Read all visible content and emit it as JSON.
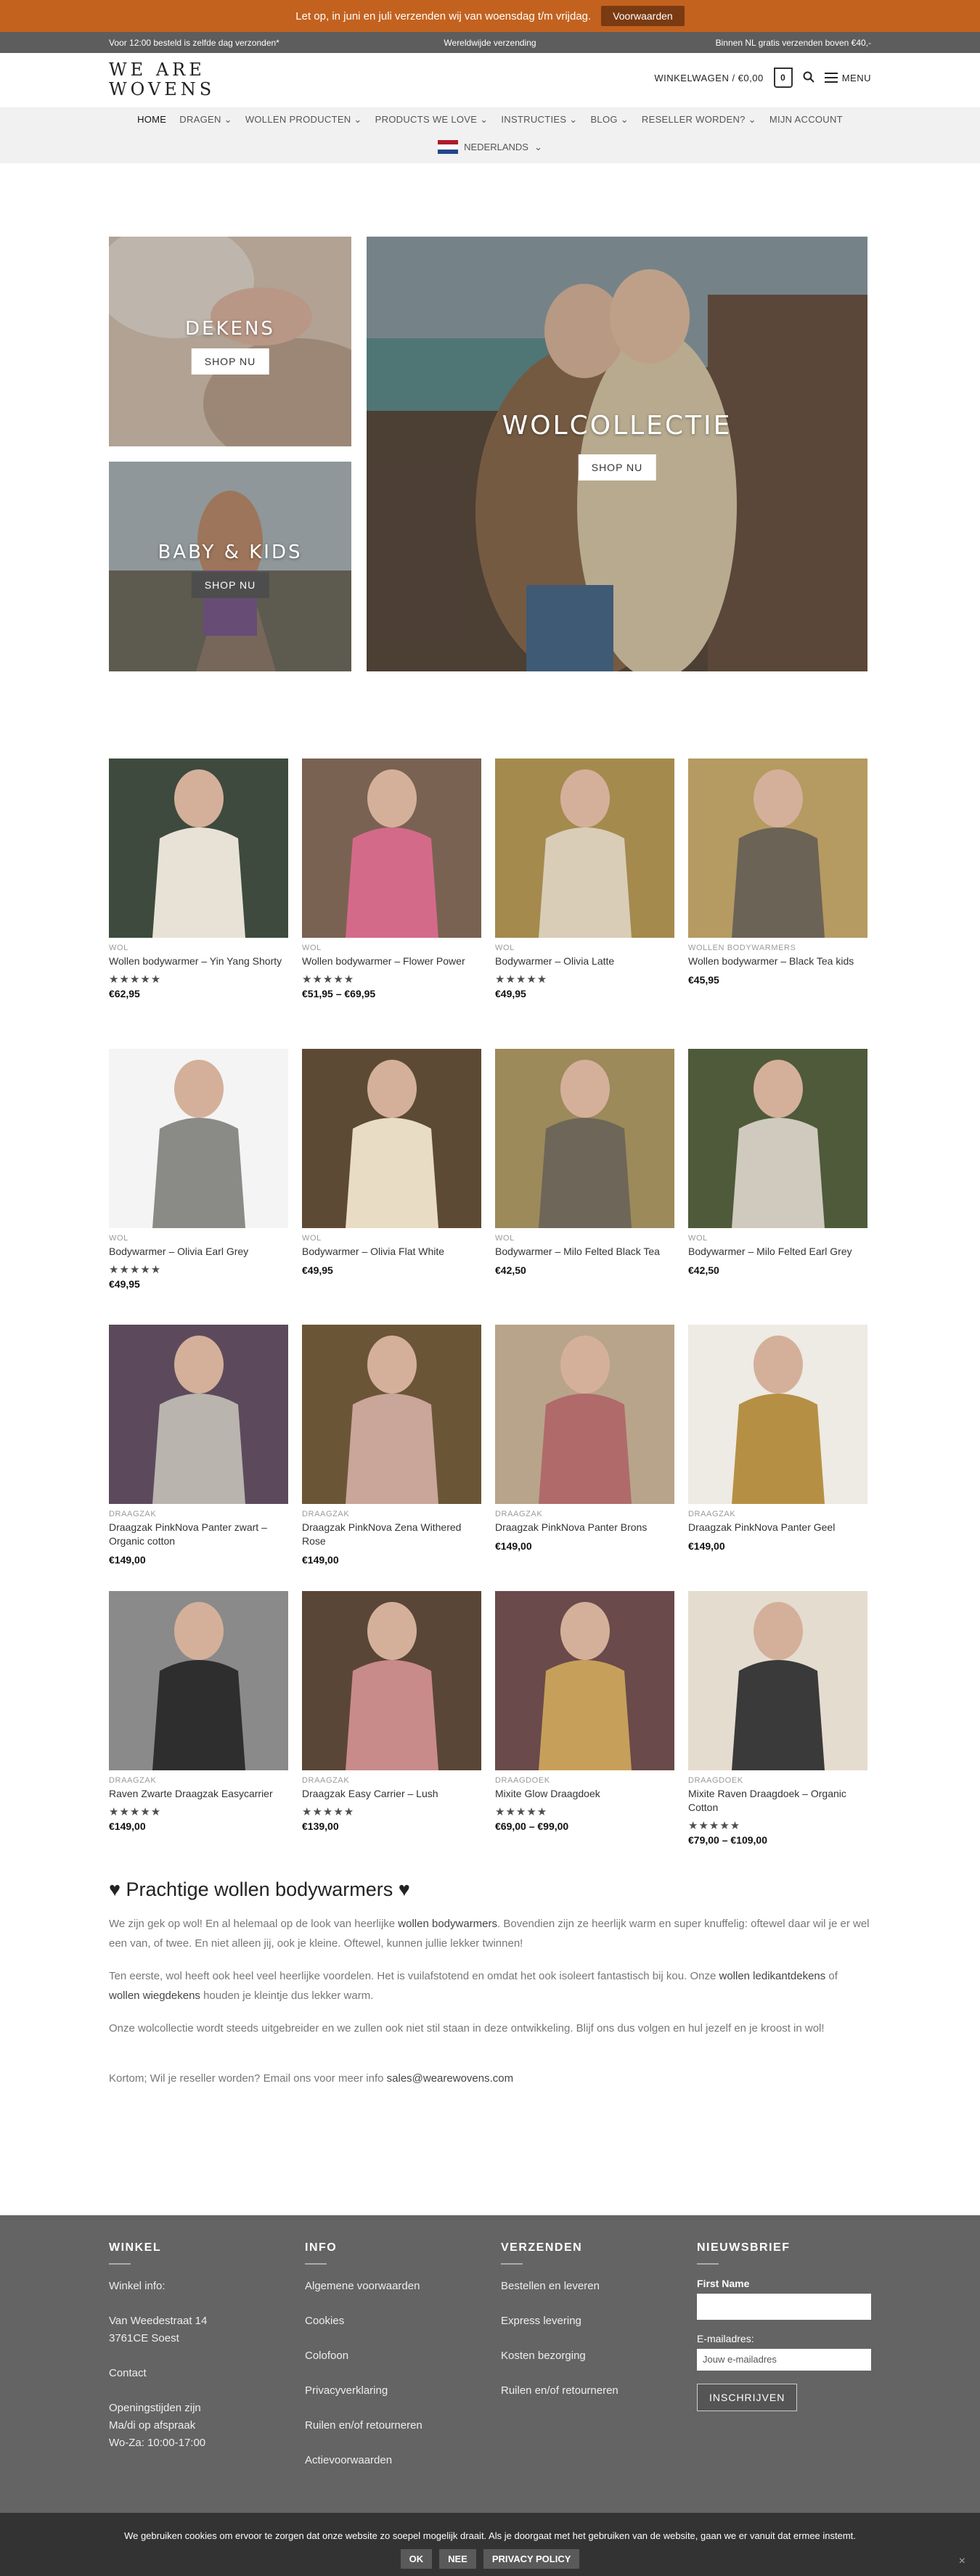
{
  "notice": {
    "text": "Let op, in juni en juli verzenden wij van woensdag t/m vrijdag.",
    "button": "Voorwaarden"
  },
  "strip": {
    "left": "Voor 12:00 besteld is zelfde dag verzonden*",
    "center": "Wereldwijde verzending",
    "right": "Binnen NL gratis verzenden boven €40,-"
  },
  "header": {
    "logo_line1": "WE ARE",
    "logo_line2": "WOVENS",
    "cart_label": "WINKELWAGEN / €0,00",
    "cart_count": "0",
    "menu_label": "MENU"
  },
  "nav": {
    "items": [
      "HOME",
      "DRAGEN",
      "WOLLEN PRODUCTEN",
      "PRODUCTS WE LOVE",
      "INSTRUCTIES",
      "BLOG",
      "RESELLER WORDEN?",
      "MIJN ACCOUNT"
    ],
    "language": "NEDERLANDS"
  },
  "banners": {
    "dekens": {
      "title": "DEKENS",
      "button": "SHOP NU"
    },
    "baby": {
      "title": "BABY & KIDS",
      "button": "SHOP NU"
    },
    "wol": {
      "title": "WOLCOLLECTIE",
      "button": "SHOP NU"
    }
  },
  "products": [
    {
      "cat": "WOL",
      "name": "Wollen bodywarmer – Yin Yang Shorty",
      "rating": 5,
      "price": "€62,95",
      "bg": "#3e4a3e",
      "fg": "#e8e2d6"
    },
    {
      "cat": "WOL",
      "name": "Wollen bodywarmer – Flower Power",
      "rating": 5,
      "price": "€51,95 – €69,95",
      "bg": "#7a6252",
      "fg": "#d46a8a"
    },
    {
      "cat": "WOL",
      "name": "Bodywarmer – Olivia Latte",
      "rating": 5,
      "price": "€49,95",
      "bg": "#a58a4e",
      "fg": "#d9cdb8"
    },
    {
      "cat": "WOLLEN BODYWARMERS",
      "name": "Wollen bodywarmer – Black Tea kids",
      "rating": 0,
      "price": "€45,95",
      "bg": "#b59a62",
      "fg": "#6b6356"
    },
    {
      "cat": "WOL",
      "name": "Bodywarmer – Olivia Earl Grey",
      "rating": 5,
      "price": "€49,95",
      "bg": "#f4f4f4",
      "fg": "#8a8a86"
    },
    {
      "cat": "WOL",
      "name": "Bodywarmer – Olivia Flat White",
      "rating": 0,
      "price": "€49,95",
      "bg": "#5d4a34",
      "fg": "#e8dcc4"
    },
    {
      "cat": "WOL",
      "name": "Bodywarmer – Milo Felted Black Tea",
      "rating": 0,
      "price": "€42,50",
      "bg": "#9c8a5a",
      "fg": "#6e6658"
    },
    {
      "cat": "WOL",
      "name": "Bodywarmer – Milo Felted Earl Grey",
      "rating": 0,
      "price": "€42,50",
      "bg": "#4e5a3a",
      "fg": "#cfcabd"
    },
    {
      "cat": "DRAAGZAK",
      "name": "Draagzak PinkNova Panter zwart – Organic cotton",
      "rating": 0,
      "price": "€149,00",
      "bg": "#5c4a5c",
      "fg": "#b9b4ae"
    },
    {
      "cat": "DRAAGZAK",
      "name": "Draagzak PinkNova Zena Withered Rose",
      "rating": 0,
      "price": "€149,00",
      "bg": "#6a5636",
      "fg": "#c9a59a"
    },
    {
      "cat": "DRAAGZAK",
      "name": "Draagzak PinkNova Panter Brons",
      "rating": 0,
      "price": "€149,00",
      "bg": "#b8a48a",
      "fg": "#b06a6a"
    },
    {
      "cat": "DRAAGZAK",
      "name": "Draagzak PinkNova Panter Geel",
      "rating": 0,
      "price": "€149,00",
      "bg": "#eeeae4",
      "fg": "#b59044"
    },
    {
      "cat": "DRAAGZAK",
      "name": "Raven Zwarte Draagzak Easycarrier",
      "rating": 5,
      "price": "€149,00",
      "bg": "#8a8a8a",
      "fg": "#2e2e2e"
    },
    {
      "cat": "DRAAGZAK",
      "name": "Draagzak Easy Carrier – Lush",
      "rating": 5,
      "price": "€139,00",
      "bg": "#5a4636",
      "fg": "#c98a8a"
    },
    {
      "cat": "DRAAGDOEK",
      "name": "Mixite Glow Draagdoek",
      "rating": 5,
      "price": "€69,00 – €99,00",
      "bg": "#6a4a4a",
      "fg": "#c6a05a"
    },
    {
      "cat": "DRAAGDOEK",
      "name": "Mixite Raven Draagdoek – Organic Cotton",
      "rating": 5,
      "price": "€79,00 – €109,00",
      "bg": "#e4dccf",
      "fg": "#3a3a3a"
    }
  ],
  "content": {
    "heading": "♥ Prachtige wollen bodywarmers ♥",
    "p1a": "We zijn gek op wol! En al helemaal op de look van heerlijke ",
    "p1link": "wollen bodywarmers",
    "p1b": ". Bovendien zijn ze heerlijk warm en super knuffelig: oftewel daar wil je er wel een van, of twee. En niet alleen jij, ook je kleine. Oftewel, kunnen jullie lekker twinnen!",
    "p2a": "Ten eerste, wol heeft ook heel veel heerlijke voordelen. Het is vuilafstotend en omdat het ook isoleert fantastisch bij kou. Onze ",
    "p2link1": "wollen ledikantdekens",
    "p2mid": " of ",
    "p2link2": "wollen wiegdekens",
    "p2b": " houden je kleintje dus lekker warm.",
    "p3": "Onze wolcollectie wordt steeds uitgebreider en we zullen ook niet stil staan in deze ontwikkeling. Blijf ons dus volgen en hul jezelf en je kroost in wol!",
    "p4a": "Kortom; Wil je reseller worden? Email ons voor meer info ",
    "p4link": "sales@wearewovens.com"
  },
  "footer": {
    "winkel": {
      "title": "WINKEL",
      "info": "Winkel info:",
      "addr1": "Van Weedestraat 14",
      "addr2": "3761CE Soest",
      "contact": "Contact",
      "hours1": "Openingstijden zijn",
      "hours2": "Ma/di op afspraak",
      "hours3": "Wo-Za: 10:00-17:00"
    },
    "info": {
      "title": "INFO",
      "links": [
        "Algemene voorwaarden",
        "Cookies",
        "Colofoon",
        "Privacyverklaring",
        "Ruilen en/of retourneren",
        "Actievoorwaarden"
      ]
    },
    "verzenden": {
      "title": "VERZENDEN",
      "links": [
        "Bestellen en leveren",
        "Express levering",
        "Kosten bezorging",
        "Ruilen en/of retourneren"
      ]
    },
    "nieuwsbrief": {
      "title": "NIEUWSBRIEF",
      "first_label": "First Name",
      "email_label": "E-mailadres:",
      "email_placeholder": "Jouw e-mailadres",
      "button": "INSCHRIJVEN"
    }
  },
  "cookie": {
    "text": "We gebruiken cookies om ervoor te zorgen dat onze website zo soepel mogelijk draait. Als je doorgaat met het gebruiken van de website, gaan we er vanuit dat ermee instemt.",
    "ok": "OK",
    "nee": "NEE",
    "privacy": "PRIVACY POLICY",
    "close": "×"
  },
  "colors": {
    "notice": "#c3621f",
    "footer": "#646464",
    "cookie": "#333333"
  }
}
